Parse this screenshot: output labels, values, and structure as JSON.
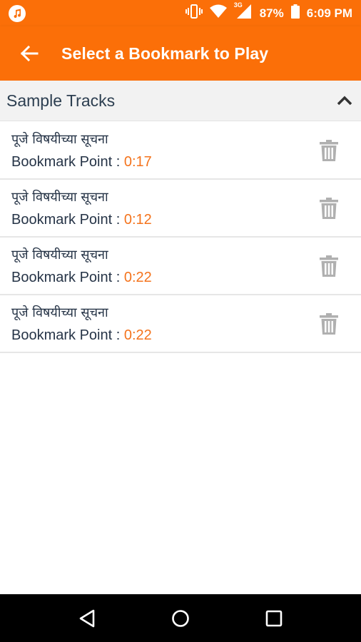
{
  "status_bar": {
    "battery_percent": "87%",
    "time": "6:09 PM",
    "network_type": "3G",
    "icons": [
      "music-icon",
      "vibrate-icon",
      "wifi-icon",
      "signal-icon",
      "battery-icon"
    ]
  },
  "app_bar": {
    "title": "Select a Bookmark to Play",
    "background_color": "#fb6f08"
  },
  "section": {
    "title": "Sample Tracks",
    "expanded": true
  },
  "bookmarks": [
    {
      "track": "पूजे विषयीच्या सूचना",
      "label": "Bookmark Point :",
      "time": "0:17"
    },
    {
      "track": "पूजे विषयीच्या सूचना",
      "label": "Bookmark Point :",
      "time": "0:12"
    },
    {
      "track": "पूजे विषयीच्या सूचना",
      "label": "Bookmark Point :",
      "time": "0:22"
    },
    {
      "track": "पूजे विषयीच्या सूचना",
      "label": "Bookmark Point :",
      "time": "0:22"
    }
  ],
  "colors": {
    "accent": "#fb6f08",
    "time_text": "#f4731c",
    "primary_text": "#263447",
    "trash_icon": "#b0b0b0"
  },
  "nav": [
    "back-triangle-icon",
    "home-circle-icon",
    "recents-square-icon"
  ]
}
